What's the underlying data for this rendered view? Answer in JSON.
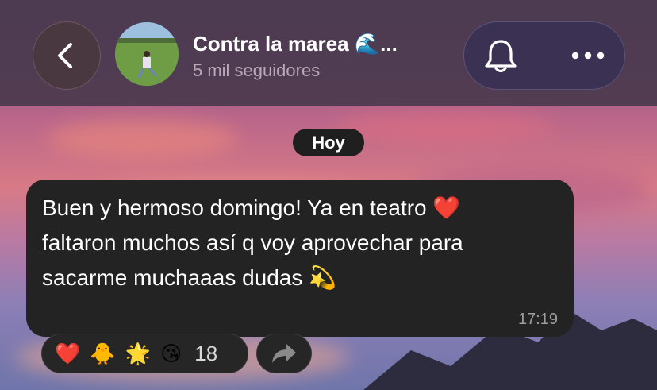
{
  "header": {
    "title": "Contra la marea 🌊...",
    "subtitle": "5 mil seguidores",
    "back_icon": "chevron-left-icon",
    "bell_icon": "bell-icon",
    "more_icon": "more-horizontal-icon"
  },
  "date_chip": "Hoy",
  "message": {
    "text": "Buen y hermoso domingo! Ya en teatro ❤️ faltaron muchos así q voy aprovechar para sacarme muchaaas dudas 💫",
    "time": "17:19"
  },
  "reactions": {
    "emojis": [
      "❤️",
      "🐥",
      "🌟",
      "😘"
    ],
    "count": "18"
  },
  "forward_icon": "share-forward-icon",
  "colors": {
    "topbar": "#4a3a4e",
    "bubble": "#232323",
    "pill": "#3b3152"
  }
}
